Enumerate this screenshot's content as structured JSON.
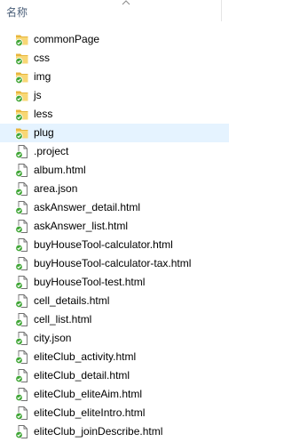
{
  "header": {
    "name_label": "名称"
  },
  "selected_index": 5,
  "items": [
    {
      "label": "commonPage",
      "type": "folder"
    },
    {
      "label": "css",
      "type": "folder"
    },
    {
      "label": "img",
      "type": "folder"
    },
    {
      "label": "js",
      "type": "folder"
    },
    {
      "label": "less",
      "type": "folder"
    },
    {
      "label": "plug",
      "type": "folder"
    },
    {
      "label": ".project",
      "type": "file"
    },
    {
      "label": "album.html",
      "type": "file"
    },
    {
      "label": "area.json",
      "type": "file"
    },
    {
      "label": "askAnswer_detail.html",
      "type": "file"
    },
    {
      "label": "askAnswer_list.html",
      "type": "file"
    },
    {
      "label": "buyHouseTool-calculator.html",
      "type": "file"
    },
    {
      "label": "buyHouseTool-calculator-tax.html",
      "type": "file"
    },
    {
      "label": "buyHouseTool-test.html",
      "type": "file"
    },
    {
      "label": "cell_details.html",
      "type": "file"
    },
    {
      "label": "cell_list.html",
      "type": "file"
    },
    {
      "label": "city.json",
      "type": "file"
    },
    {
      "label": "eliteClub_activity.html",
      "type": "file"
    },
    {
      "label": "eliteClub_detail.html",
      "type": "file"
    },
    {
      "label": "eliteClub_eliteAim.html",
      "type": "file"
    },
    {
      "label": "eliteClub_eliteIntro.html",
      "type": "file"
    },
    {
      "label": "eliteClub_joinDescribe.html",
      "type": "file"
    }
  ],
  "colors": {
    "selection": "#e5f3ff",
    "folder": "#f5d16a",
    "badge": "#3fa535",
    "header_text": "#4c607a"
  }
}
